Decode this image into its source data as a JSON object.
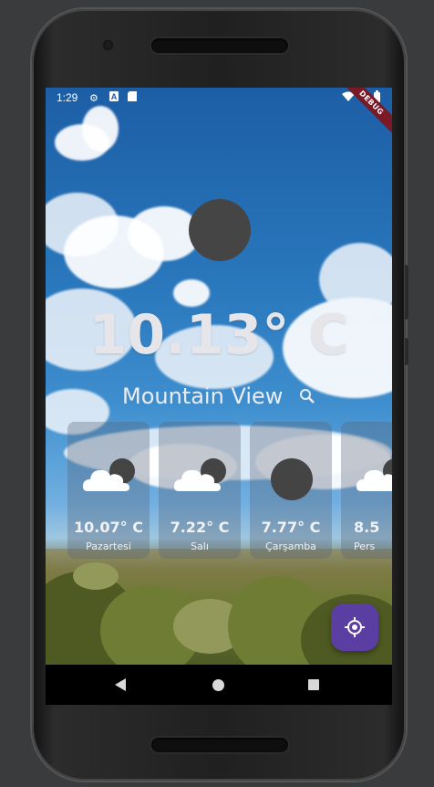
{
  "status_bar": {
    "time": "1:29",
    "debug_label": "DEBUG",
    "icons": [
      "settings-icon",
      "a-icon",
      "sd-card-icon",
      "wifi-icon",
      "battery-icon"
    ]
  },
  "current": {
    "temperature": "10.13° C",
    "location": "Mountain View",
    "icon": "weather-circle-icon"
  },
  "forecast": [
    {
      "temp": "10.07° C",
      "day": "Pazartesi",
      "icon": "cloud-icon"
    },
    {
      "temp": "7.22° C",
      "day": "Salı",
      "icon": "cloud-icon"
    },
    {
      "temp": "7.77° C",
      "day": "Çarşamba",
      "icon": "weather-circle-icon"
    },
    {
      "temp": "8.5",
      "day": "Pers",
      "icon": "cloud-icon"
    }
  ],
  "fab": {
    "icon": "my-location-icon",
    "color": "#5a3ea1"
  },
  "nav": {
    "icons": [
      "back-icon",
      "home-icon",
      "recents-icon"
    ]
  }
}
